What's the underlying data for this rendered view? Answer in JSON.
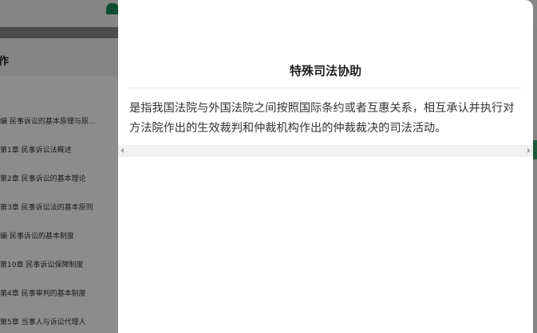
{
  "background": {
    "sidebar_title": "作",
    "toc": [
      "编 民事诉讼的基本原理与原...",
      "第1章 民事诉讼法概述",
      "第2章 民事诉讼的基本理论",
      "第3章 民事诉讼法的基本原则",
      "编 民事诉讼的基本制度",
      "第10章 民事诉讼保障制度",
      "第4章 民事审判的基本制度",
      "第5章 当事人与诉讼代理人"
    ]
  },
  "modal": {
    "title": "特殊司法协助",
    "body": "是指我国法院与外国法院之间按照国际条约或者互惠关系，相互承认并执行对方法院作出的生效裁判和仲裁机构作出的仲裁裁决的司法活动。"
  },
  "colors": {
    "brand": "#1e8a5a"
  }
}
